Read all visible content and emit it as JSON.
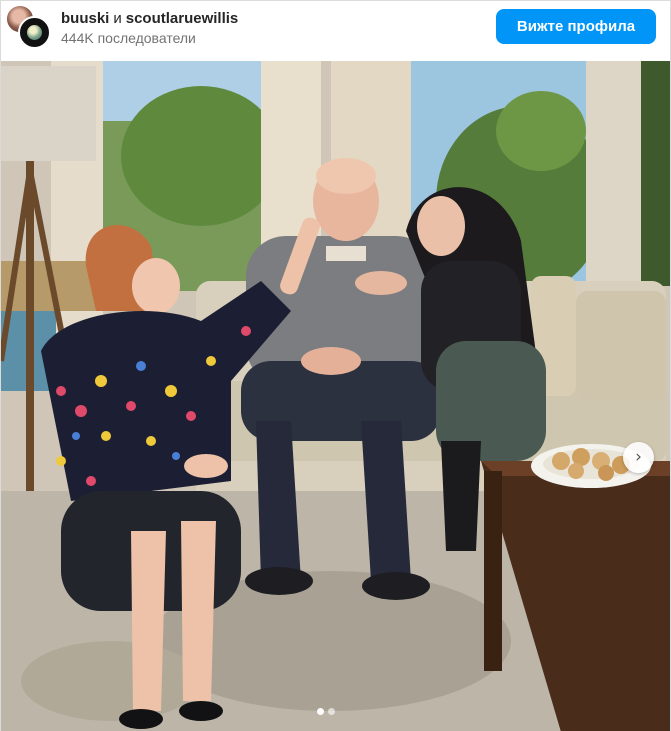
{
  "post": {
    "author_primary": "buuski",
    "conjunction": "и",
    "author_secondary": "scoutlaruewillis",
    "followers": "444K последователи",
    "view_profile_label": "Вижте профила"
  },
  "carousel": {
    "next_glyph": "›",
    "slide_count": 2,
    "active_slide": 1
  },
  "icons": {
    "next": "chevron-right-icon"
  },
  "colors": {
    "button": "#0095f6",
    "text": "#262626",
    "muted": "#737373"
  }
}
